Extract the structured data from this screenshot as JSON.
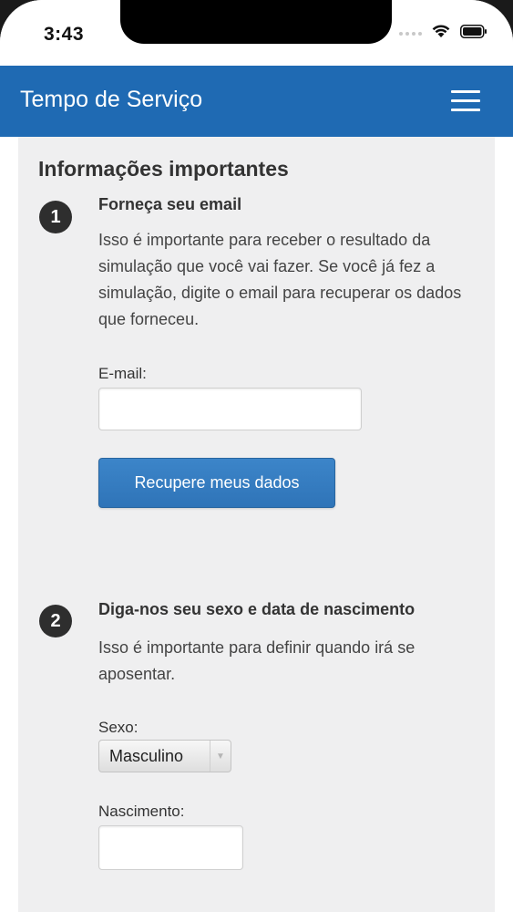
{
  "status_bar": {
    "time": "3:43"
  },
  "navbar": {
    "title": "Tempo de Serviço",
    "menu_icon": "hamburger-menu-icon",
    "background": "#1f6ab3"
  },
  "main": {
    "section_title": "Informações importantes",
    "steps": [
      {
        "number": "1",
        "heading": "Forneça seu email",
        "text": "Isso é importante para receber o resultado da simulação que você vai fazer. Se você já fez a simulação, digite o email para recuperar os dados que forneceu.",
        "email_label": "E-mail:",
        "email_value": "",
        "button_label": "Recupere meus dados"
      },
      {
        "number": "2",
        "heading": "Diga-nos seu sexo e data de nascimento",
        "text": "Isso é importante para definir quando irá se aposentar.",
        "sexo_label": "Sexo:",
        "sexo_value": "Masculino",
        "nascimento_label": "Nascimento:",
        "nascimento_value": ""
      }
    ]
  },
  "colors": {
    "accent": "#2f74b8",
    "content_background": "#efeff0",
    "badge": "#2e2e2e"
  }
}
